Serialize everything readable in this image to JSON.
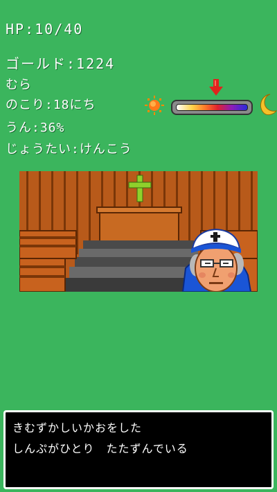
{
  "status": {
    "hp": "HP:10/40",
    "gold": "ゴールド:1224",
    "location": "むら",
    "days_left": "のこり:18にち",
    "luck": "うん:36%",
    "condition": "じょうたい:けんこう"
  },
  "time_gauge": {
    "sun_icon": "sun-icon",
    "moon_icon": "crescent-moon-icon",
    "marker_icon": "down-arrow-icon",
    "position_fraction": 0.55
  },
  "scene": {
    "location": "church",
    "character": "priest",
    "colors": {
      "wall": "#b85a1a",
      "cross": "#8fd02c",
      "robe": "#1a55d6"
    }
  },
  "message": {
    "line1": "きむずかしいかおをした",
    "line2": "しんぷがひとり　たたずんでいる"
  },
  "colors": {
    "background": "#3bb55d",
    "text": "#ffffff",
    "message_bg": "#000000"
  }
}
